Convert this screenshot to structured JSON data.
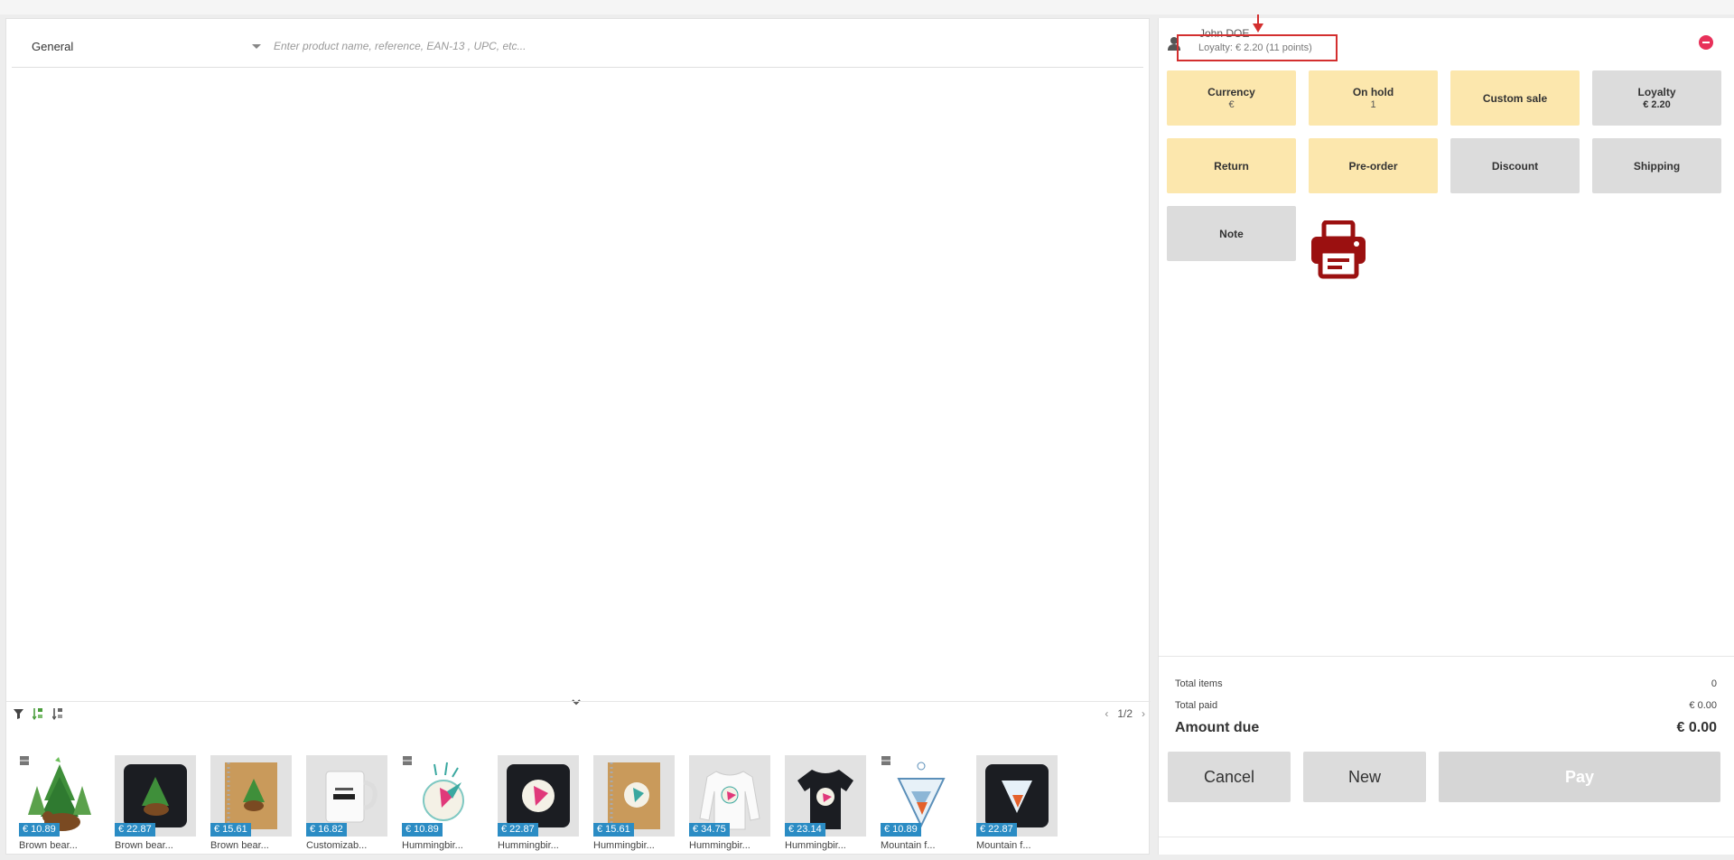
{
  "search": {
    "category": "General",
    "placeholder": "Enter product name, reference, EAN-13 , UPC, etc..."
  },
  "pager": {
    "page": "1/2",
    "prev_icon": "chevron-left-icon",
    "next_icon": "chevron-right-icon"
  },
  "products": [
    {
      "price": "€ 10.89",
      "name": "Brown bear...",
      "pack": true
    },
    {
      "price": "€ 22.87",
      "name": "Brown bear...",
      "pack": false
    },
    {
      "price": "€ 15.61",
      "name": "Brown bear...",
      "pack": false
    },
    {
      "price": "€ 16.82",
      "name": "Customizab...",
      "pack": false
    },
    {
      "price": "€ 10.89",
      "name": "Hummingbir...",
      "pack": true
    },
    {
      "price": "€ 22.87",
      "name": "Hummingbir...",
      "pack": false
    },
    {
      "price": "€ 15.61",
      "name": "Hummingbir...",
      "pack": false
    },
    {
      "price": "€ 34.75",
      "name": "Hummingbir...",
      "pack": false
    },
    {
      "price": "€ 23.14",
      "name": "Hummingbir...",
      "pack": false
    },
    {
      "price": "€ 10.89",
      "name": "Mountain f...",
      "pack": true
    },
    {
      "price": "€ 22.87",
      "name": "Mountain f...",
      "pack": false
    }
  ],
  "customer": {
    "name": "John DOE",
    "loyalty": "Loyalty: € 2.20 (11 points)"
  },
  "actions": {
    "currency": {
      "label": "Currency",
      "sub": "€"
    },
    "on_hold": {
      "label": "On hold",
      "sub": "1"
    },
    "custom_sale": {
      "label": "Custom sale"
    },
    "loyalty": {
      "label": "Loyalty",
      "sub": "€ 2.20"
    },
    "return": {
      "label": "Return"
    },
    "preorder": {
      "label": "Pre-order"
    },
    "discount": {
      "label": "Discount"
    },
    "shipping": {
      "label": "Shipping"
    },
    "note": {
      "label": "Note"
    }
  },
  "totals": {
    "items_label": "Total items",
    "items_value": "0",
    "paid_label": "Total paid",
    "paid_value": "€ 0.00",
    "due_label": "Amount due",
    "due_value": "€ 0.00"
  },
  "buttons": {
    "cancel": "Cancel",
    "new": "New",
    "pay": "Pay"
  },
  "colors": {
    "accent_yellow": "#fce7ad",
    "neutral_gray": "#dcdcdc",
    "price_blue": "#2b8cc4",
    "printer_red": "#9b1010",
    "remove_red": "#e8315a",
    "highlight_red": "#d32f2f"
  }
}
